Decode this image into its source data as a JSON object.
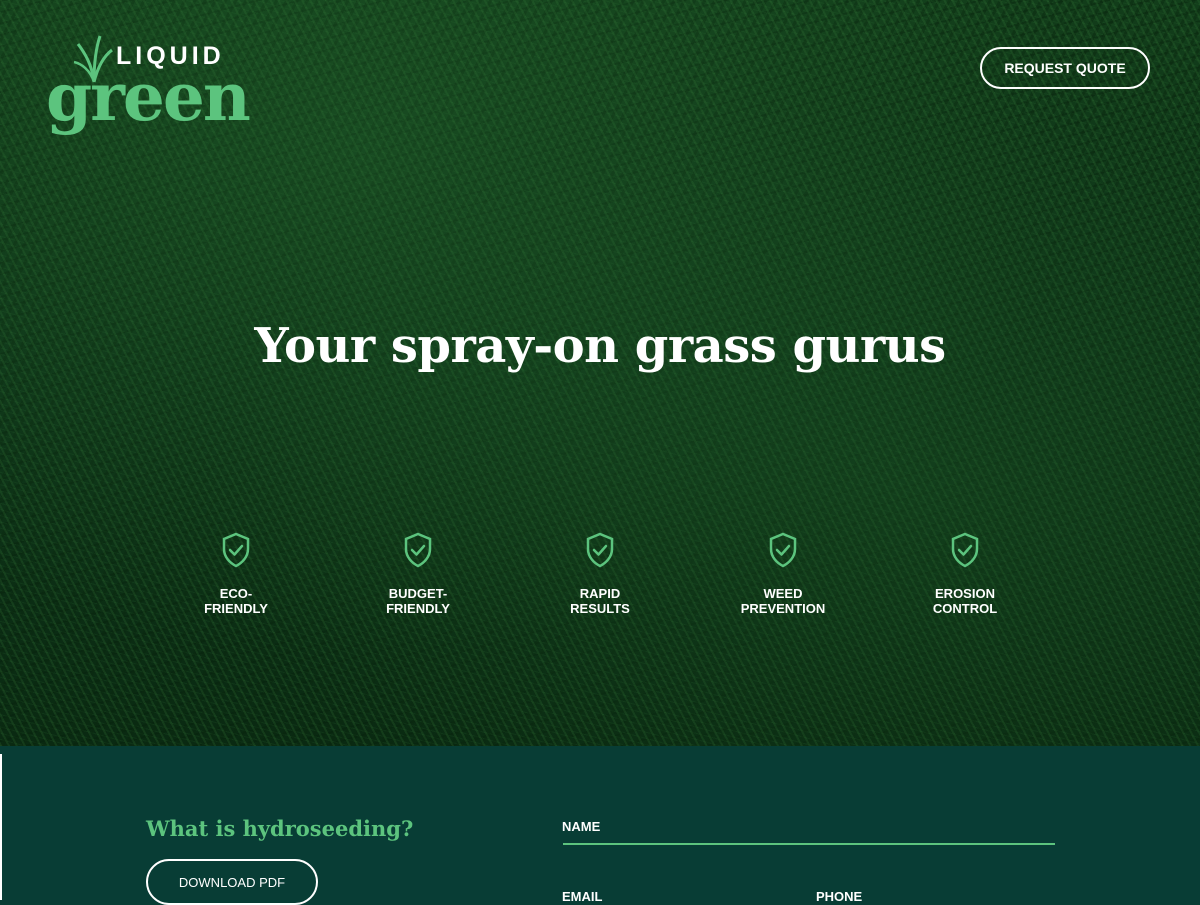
{
  "brand": {
    "logo_top": "LIQUID",
    "logo_main": "green",
    "accent_color": "#5cc47e",
    "dark_color": "#083d35"
  },
  "header": {
    "request_quote_label": "REQUEST QUOTE"
  },
  "hero": {
    "headline": "Your spray-on grass gurus",
    "features": [
      {
        "label": "ECO-\nFRIENDLY",
        "icon": "shield-check-icon"
      },
      {
        "label": "BUDGET-\nFRIENDLY",
        "icon": "shield-check-icon"
      },
      {
        "label": "RAPID\nRESULTS",
        "icon": "shield-check-icon"
      },
      {
        "label": "WEED\nPREVENTION",
        "icon": "shield-check-icon"
      },
      {
        "label": "EROSION\nCONTROL",
        "icon": "shield-check-icon"
      }
    ]
  },
  "info": {
    "title": "What is hydroseeding?",
    "download_label": "DOWNLOAD PDF"
  },
  "form": {
    "name_label": "NAME",
    "email_label": "EMAIL",
    "phone_label": "PHONE"
  }
}
